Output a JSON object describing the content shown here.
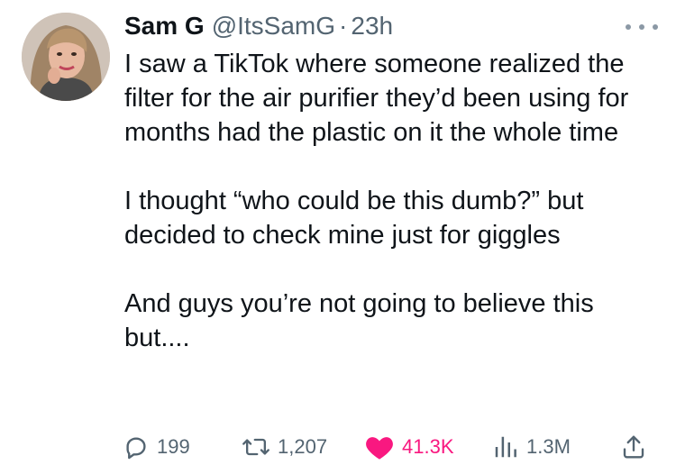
{
  "tweet": {
    "author": {
      "display_name": "Sam G",
      "handle": "@ItsSamG",
      "separator": "·",
      "timestamp": "23h"
    },
    "body": {
      "paragraph_1": "I saw a TikTok where someone realized the filter for the air purifier they’d been using for months had the plastic on it the whole time",
      "paragraph_2": "I thought “who could be this dumb?” but decided to check mine just for giggles",
      "paragraph_3": "And guys you’re not going to believe this but...."
    },
    "actions": {
      "reply_count": "199",
      "retweet_count": "1,207",
      "like_count": "41.3K",
      "views_count": "1.3M"
    },
    "icons": {
      "reply": "speech-bubble-icon",
      "retweet": "retweet-arrows-icon",
      "like": "heart-icon",
      "views": "bar-chart-icon",
      "share": "share-upload-icon",
      "more": "more-dots-icon"
    },
    "colors": {
      "text": "#0f1419",
      "secondary": "#536471",
      "like_accent": "#f91880"
    }
  }
}
